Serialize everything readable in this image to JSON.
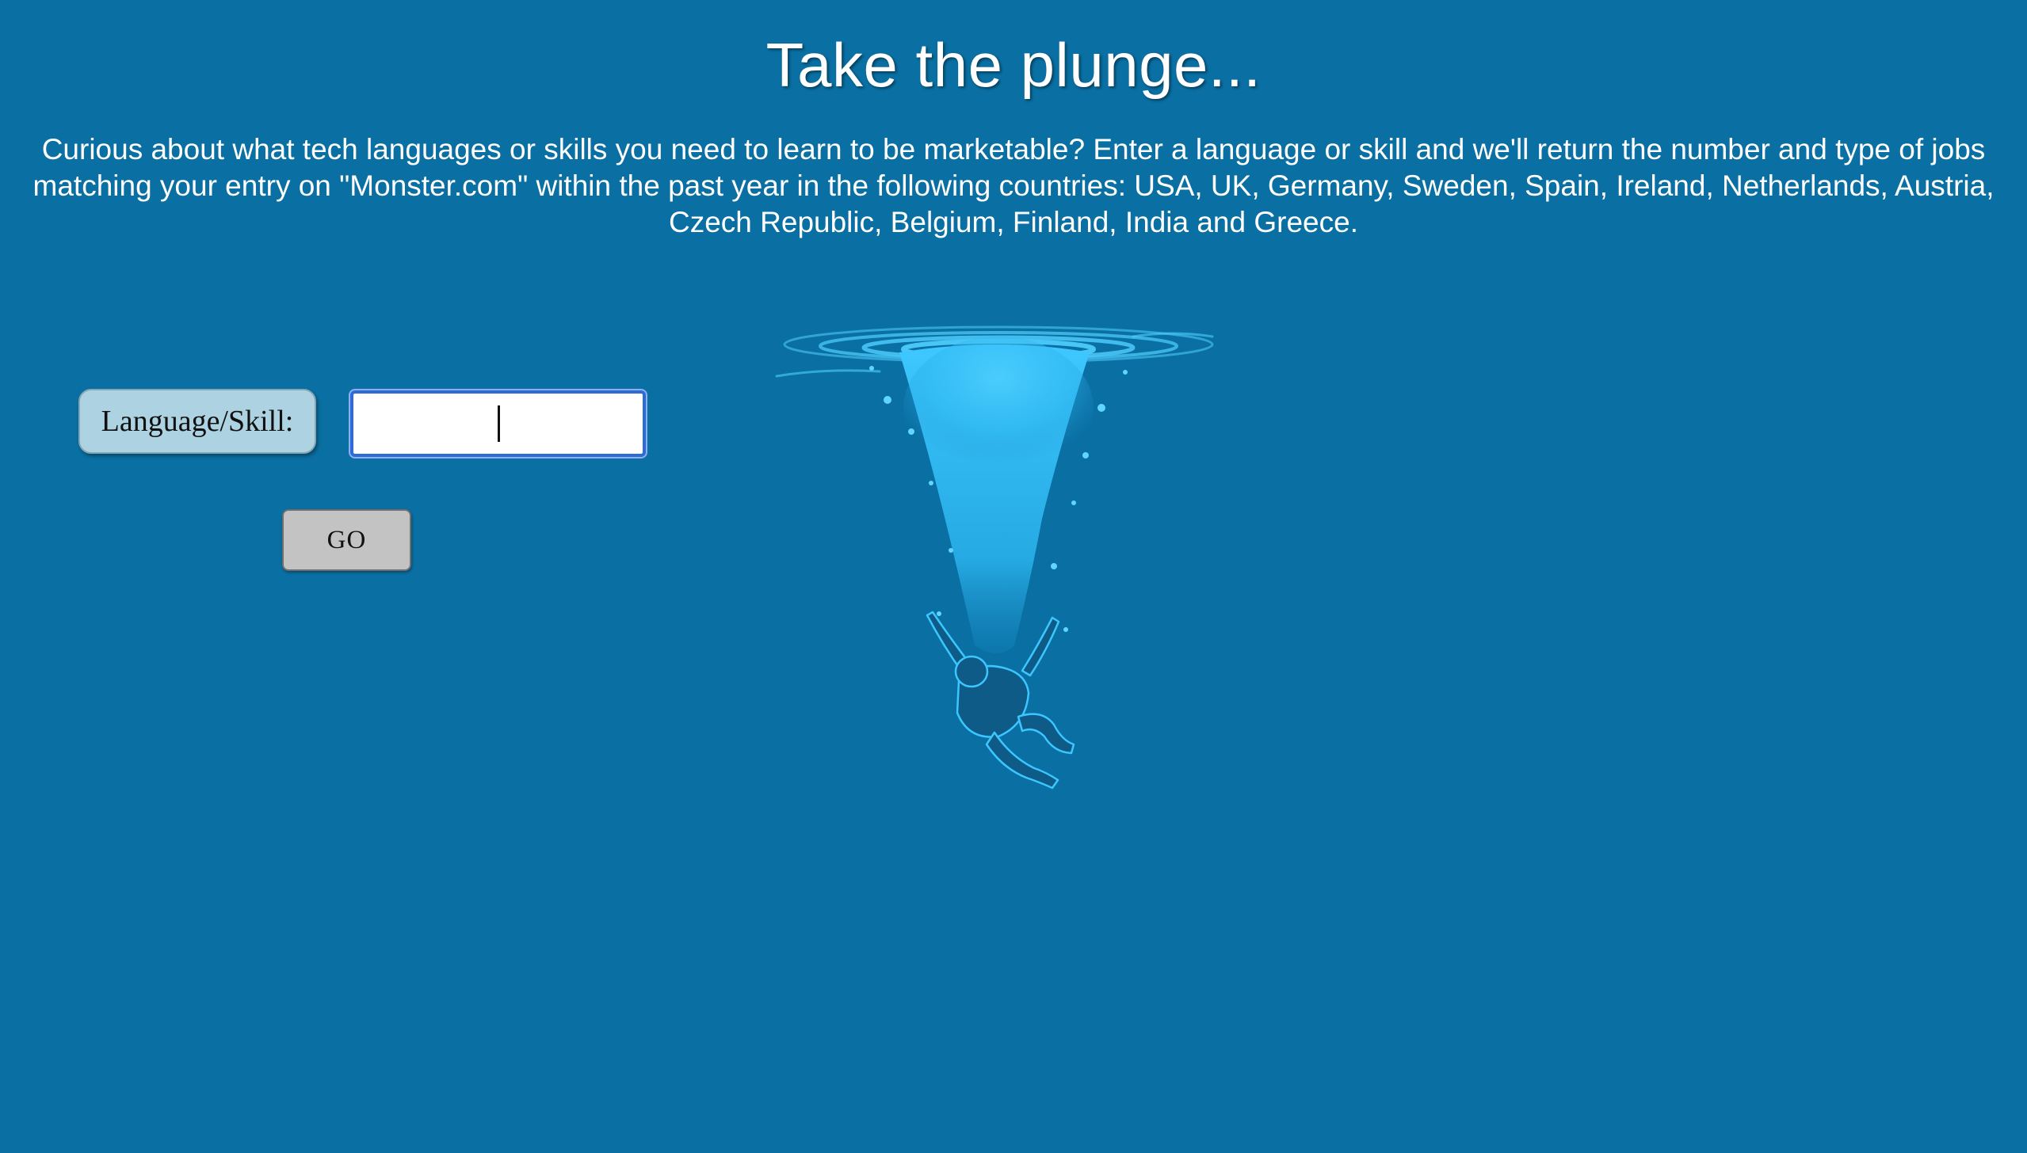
{
  "header": {
    "title": "Take the plunge...",
    "description": "Curious about what tech languages or skills you need to learn to be marketable? Enter a language or skill and we'll return the number and type of jobs matching your entry on \"Monster.com\" within the past year in the following countries: USA, UK, Germany, Sweden, Spain, Ireland, Netherlands, Austria, Czech Republic, Belgium, Finland, India and Greece."
  },
  "form": {
    "label": "Language/Skill:",
    "input_value": "",
    "submit_label": "GO"
  },
  "illustration": {
    "icon": "diver-plunge-icon"
  },
  "colors": {
    "background": "#0a6fa2",
    "splash": "#3cc6ff",
    "label_bg": "#add3e3",
    "button_bg": "#c3c3c3",
    "input_focus": "#2f6bd6"
  }
}
